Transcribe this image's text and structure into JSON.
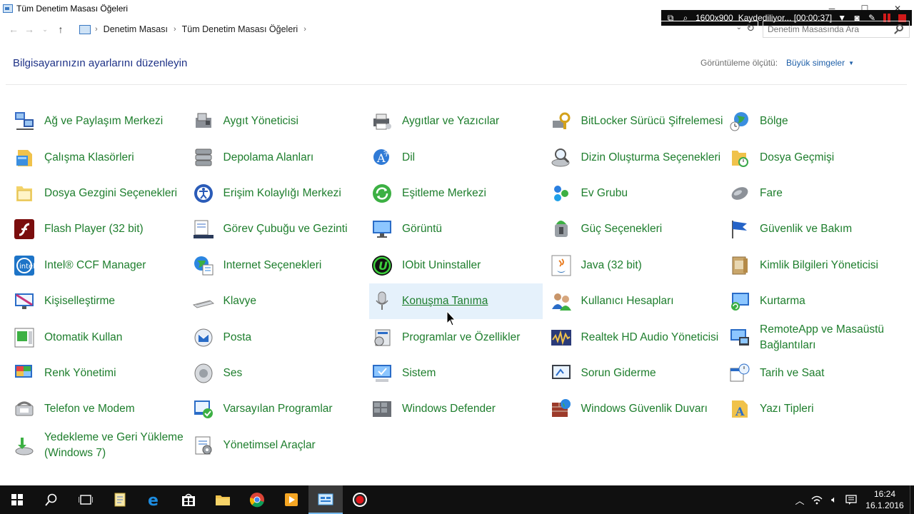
{
  "window": {
    "title": "Tüm Denetim Masası Öğeleri"
  },
  "recorder": {
    "resolution": "1600x900",
    "status": "Kaydediliyor... [00:00:37]"
  },
  "breadcrumb": {
    "items": [
      "Denetim Masası",
      "Tüm Denetim Masası Öğeleri"
    ]
  },
  "search": {
    "placeholder": "Denetim Masasında Ara"
  },
  "header": {
    "title": "Bilgisayarınızın ayarlarını düzenleyin",
    "view_by_label": "Görüntüleme ölçütü:",
    "view_by_value": "Büyük simgeler"
  },
  "items": [
    {
      "label": "Ağ ve Paylaşım Merkezi",
      "icon": "network-icon"
    },
    {
      "label": "Aygıt Yöneticisi",
      "icon": "device-manager-icon"
    },
    {
      "label": "Aygıtlar ve Yazıcılar",
      "icon": "printer-icon"
    },
    {
      "label": "BitLocker Sürücü Şifrelemesi",
      "icon": "bitlocker-icon"
    },
    {
      "label": "Bölge",
      "icon": "globe-clock-icon"
    },
    {
      "label": "Çalışma Klasörleri",
      "icon": "work-folders-icon"
    },
    {
      "label": "Depolama Alanları",
      "icon": "storage-icon"
    },
    {
      "label": "Dil",
      "icon": "language-icon"
    },
    {
      "label": "Dizin Oluşturma Seçenekleri",
      "icon": "indexing-icon"
    },
    {
      "label": "Dosya Geçmişi",
      "icon": "file-history-icon"
    },
    {
      "label": "Dosya Gezgini Seçenekleri",
      "icon": "folder-options-icon"
    },
    {
      "label": "Erişim Kolaylığı Merkezi",
      "icon": "accessibility-icon"
    },
    {
      "label": "Eşitleme Merkezi",
      "icon": "sync-icon"
    },
    {
      "label": "Ev Grubu",
      "icon": "homegroup-icon"
    },
    {
      "label": "Fare",
      "icon": "mouse-icon"
    },
    {
      "label": "Flash Player (32 bit)",
      "icon": "flash-icon"
    },
    {
      "label": "Görev Çubuğu ve Gezinti",
      "icon": "taskbar-icon"
    },
    {
      "label": "Görüntü",
      "icon": "display-icon"
    },
    {
      "label": "Güç Seçenekleri",
      "icon": "power-icon"
    },
    {
      "label": "Güvenlik ve Bakım",
      "icon": "flag-icon"
    },
    {
      "label": "Intel® CCF Manager",
      "icon": "intel-icon"
    },
    {
      "label": "Internet Seçenekleri",
      "icon": "internet-options-icon"
    },
    {
      "label": "IObit Uninstaller",
      "icon": "iobit-icon"
    },
    {
      "label": "Java (32 bit)",
      "icon": "java-icon"
    },
    {
      "label": "Kimlik Bilgileri Yöneticisi",
      "icon": "credentials-icon"
    },
    {
      "label": "Kişiselleştirme",
      "icon": "personalization-icon"
    },
    {
      "label": "Klavye",
      "icon": "keyboard-icon"
    },
    {
      "label": "Konuşma Tanıma",
      "icon": "microphone-icon"
    },
    {
      "label": "Kullanıcı Hesapları",
      "icon": "users-icon"
    },
    {
      "label": "Kurtarma",
      "icon": "recovery-icon"
    },
    {
      "label": "Otomatik Kullan",
      "icon": "autoplay-icon"
    },
    {
      "label": "Posta",
      "icon": "mail-icon"
    },
    {
      "label": "Programlar ve Özellikler",
      "icon": "programs-icon"
    },
    {
      "label": "Realtek HD Audio Yöneticisi",
      "icon": "realtek-icon"
    },
    {
      "label": "RemoteApp ve Masaüstü Bağlantıları",
      "icon": "remoteapp-icon"
    },
    {
      "label": "Renk Yönetimi",
      "icon": "color-management-icon"
    },
    {
      "label": "Ses",
      "icon": "speaker-icon"
    },
    {
      "label": "Sistem",
      "icon": "system-icon"
    },
    {
      "label": "Sorun Giderme",
      "icon": "troubleshoot-icon"
    },
    {
      "label": "Tarih ve Saat",
      "icon": "calendar-clock-icon"
    },
    {
      "label": "Telefon ve Modem",
      "icon": "phone-icon"
    },
    {
      "label": "Varsayılan Programlar",
      "icon": "default-programs-icon"
    },
    {
      "label": "Windows Defender",
      "icon": "defender-icon"
    },
    {
      "label": "Windows Güvenlik Duvarı",
      "icon": "firewall-icon"
    },
    {
      "label": "Yazı Tipleri",
      "icon": "fonts-icon"
    },
    {
      "label": "Yedekleme ve Geri Yükleme (Windows 7)",
      "icon": "backup-icon"
    },
    {
      "label": "Yönetimsel Araçlar",
      "icon": "admin-tools-icon"
    }
  ],
  "hovered_item": "Konuşma Tanıma",
  "taskbar": {
    "apps": [
      "start-icon",
      "search-icon",
      "task-view-icon",
      "notepad-icon",
      "edge-icon",
      "store-icon",
      "explorer-icon",
      "chrome-icon",
      "media-icon",
      "control-panel-icon",
      "record-icon"
    ],
    "clock_time": "16:24",
    "clock_date": "16.1.2016"
  },
  "colors": {
    "link_green": "#1e7e2d",
    "heading_blue": "#1e3287",
    "hover_bg": "#e5f1fb"
  }
}
